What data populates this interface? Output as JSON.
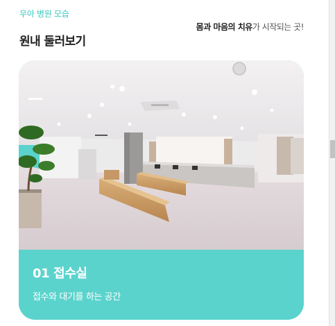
{
  "section": {
    "eyebrow": "우아 병원 모습",
    "title": "원내 둘러보기",
    "tagline_bold_1": "몸과 마음의 치유",
    "tagline_rest": "가 시작되는 곳!"
  },
  "slide": {
    "title": "01 접수실",
    "description": "접수와 대기를 하는 공간",
    "photo_alt": "접수실",
    "accent_color": "#5bd3cd"
  },
  "colors": {
    "eyebrow": "#3cc6c0",
    "heading": "#222222"
  }
}
